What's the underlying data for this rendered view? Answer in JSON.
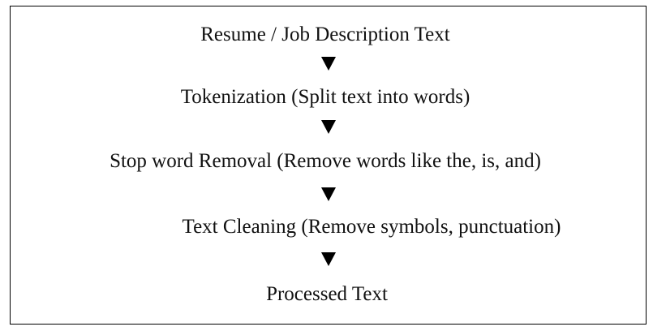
{
  "flow": {
    "steps": [
      "Resume / Job Description Text",
      "Tokenization (Split text into words)",
      "Stop word Removal (Remove words like the, is, and)",
      "Text Cleaning (Remove symbols, punctuation)",
      "Processed Text"
    ]
  }
}
